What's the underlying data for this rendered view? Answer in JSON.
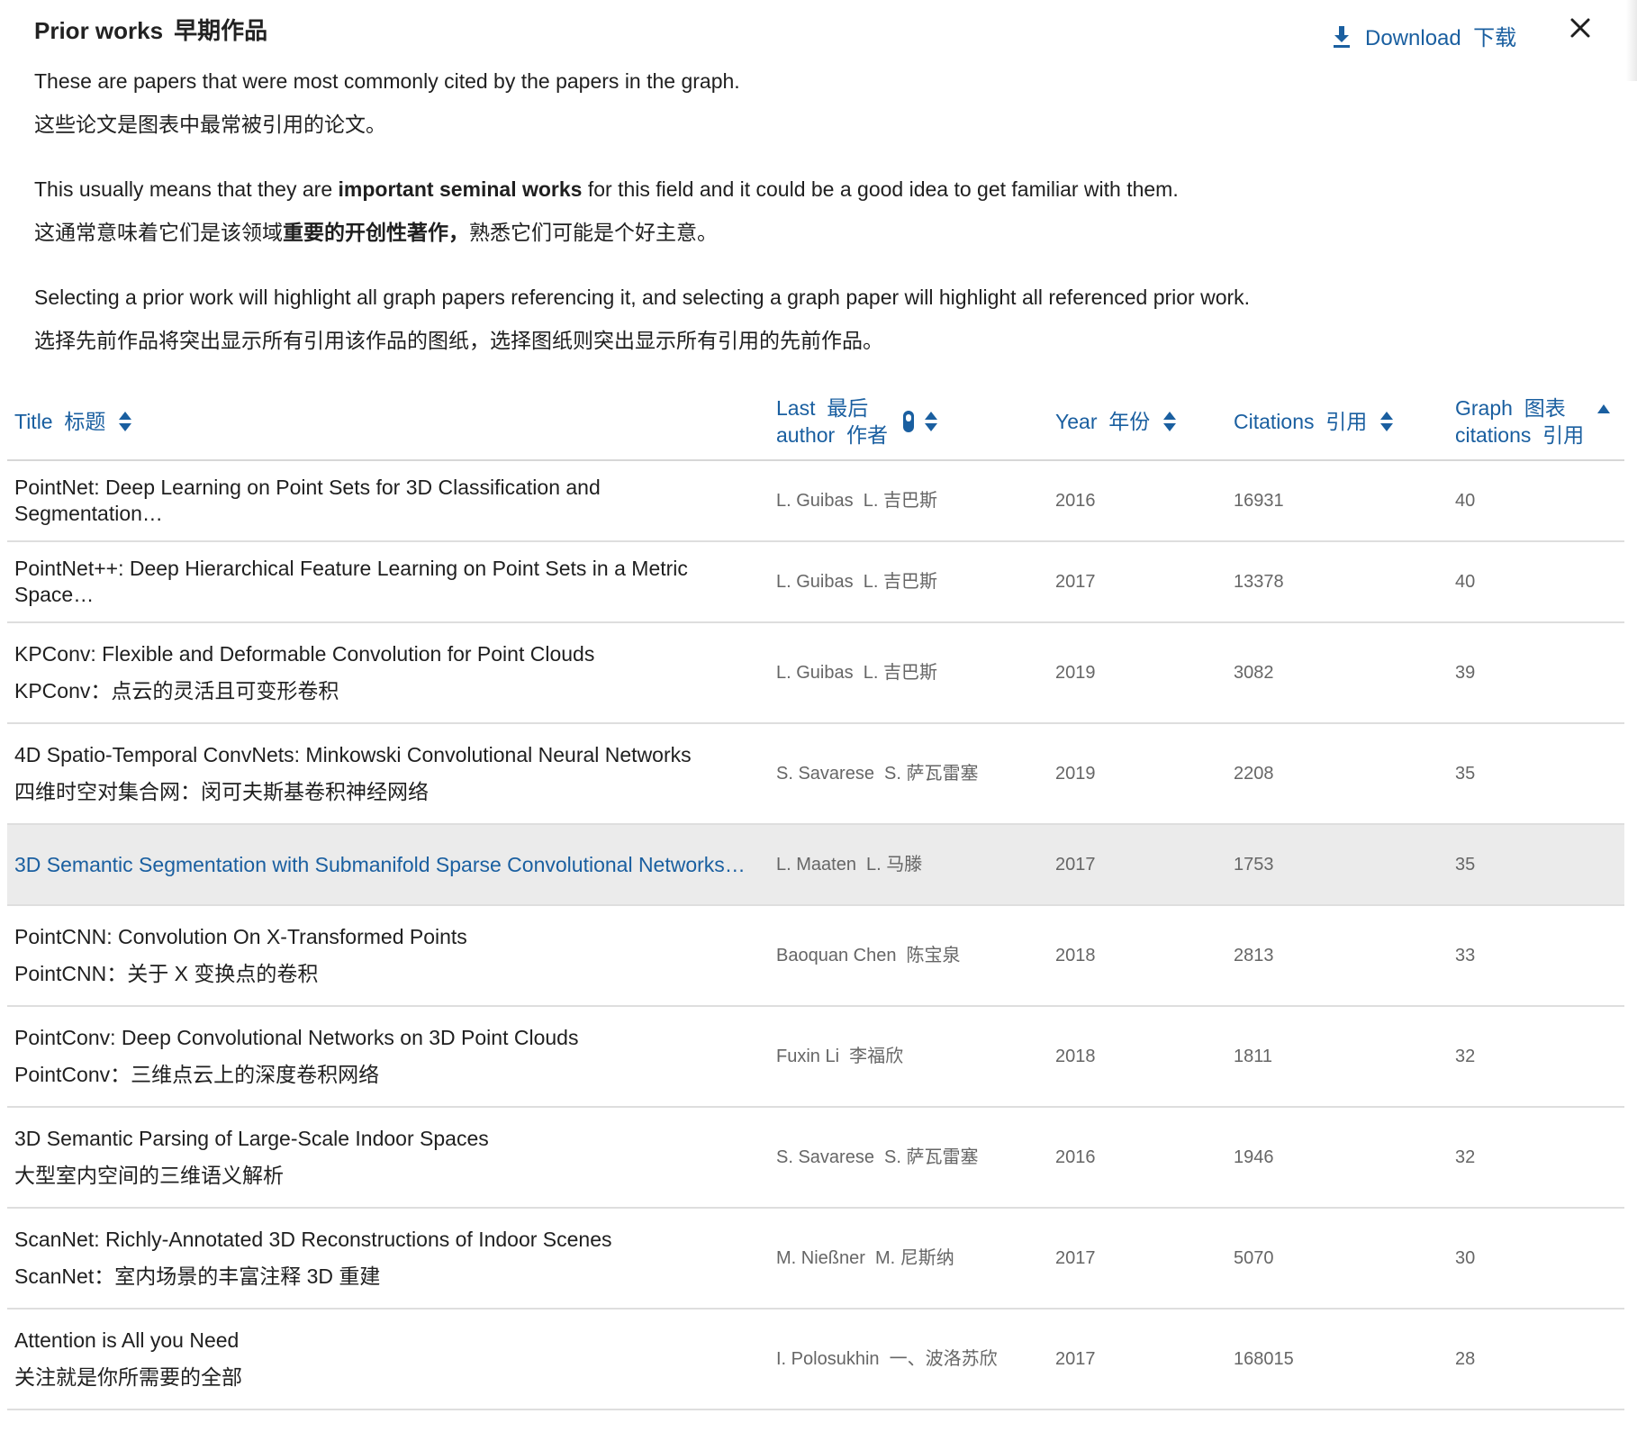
{
  "panel": {
    "title": "Prior works",
    "title_zh": "早期作品",
    "download_label": "Download  下载",
    "download_icon": "download-icon",
    "close_icon": "close-icon"
  },
  "intro": {
    "p1_en": "These are papers that were most commonly cited by the papers in the graph.",
    "p1_zh": "这些论文是图表中最常被引用的论文。",
    "p2_en_before": "This usually means that they are ",
    "p2_en_bold": "important seminal works",
    "p2_en_after": " for this field and it could be a good idea to get familiar with them.",
    "p2_zh_before": "这通常意味着它们是该领域",
    "p2_zh_bold": "重要的开创性著作，",
    "p2_zh_after": "熟悉它们可能是个好主意。",
    "p3_en": "Selecting a prior work will highlight all graph papers referencing it, and selecting a graph paper will highlight all referenced prior work.",
    "p3_zh": "选择先前作品将突出显示所有引用该作品的图纸，选择图纸则突出显示所有引用的先前作品。"
  },
  "table": {
    "headers": {
      "title": "Title  标题",
      "last_author_1": "Last  最后",
      "last_author_2": "author  作者",
      "year": "Year  年份",
      "citations": "Citations  引用",
      "graph_1": "Graph  图表",
      "graph_2": "citations  引用"
    },
    "rows": [
      {
        "title": "PointNet: Deep Learning on Point Sets for 3D Classification and Segmentation…",
        "title_zh": "",
        "author": "L. Guibas  L. 吉巴斯",
        "year": "2016",
        "citations": "16931",
        "graph": "40"
      },
      {
        "title": "PointNet++: Deep Hierarchical Feature Learning on Point Sets in a Metric Space…",
        "title_zh": "",
        "author": "L. Guibas  L. 吉巴斯",
        "year": "2017",
        "citations": "13378",
        "graph": "40"
      },
      {
        "title": "KPConv: Flexible and Deformable Convolution for Point Clouds",
        "title_zh": "KPConv：点云的灵活且可变形卷积",
        "author": "L. Guibas  L. 吉巴斯",
        "year": "2019",
        "citations": "3082",
        "graph": "39"
      },
      {
        "title": "4D Spatio-Temporal ConvNets: Minkowski Convolutional Neural Networks",
        "title_zh": "四维时空对集合网：闵可夫斯基卷积神经网络",
        "author": "S. Savarese  S. 萨瓦雷塞",
        "year": "2019",
        "citations": "2208",
        "graph": "35"
      },
      {
        "title": "3D Semantic Segmentation with Submanifold Sparse Convolutional Networks…",
        "title_zh": "",
        "author": "L. Maaten  L. 马滕",
        "year": "2017",
        "citations": "1753",
        "graph": "35"
      },
      {
        "title": "PointCNN: Convolution On X-Transformed Points",
        "title_zh": "PointCNN：关于 X 变换点的卷积",
        "author": "Baoquan Chen  陈宝泉",
        "year": "2018",
        "citations": "2813",
        "graph": "33"
      },
      {
        "title": "PointConv: Deep Convolutional Networks on 3D Point Clouds",
        "title_zh": "PointConv：三维点云上的深度卷积网络",
        "author": "Fuxin Li  李福欣",
        "year": "2018",
        "citations": "1811",
        "graph": "32"
      },
      {
        "title": "3D Semantic Parsing of Large-Scale Indoor Spaces",
        "title_zh": "大型室内空间的三维语义解析",
        "author": "S. Savarese  S. 萨瓦雷塞",
        "year": "2016",
        "citations": "1946",
        "graph": "32"
      },
      {
        "title": "ScanNet: Richly-Annotated 3D Reconstructions of Indoor Scenes",
        "title_zh": "ScanNet：室内场景的丰富注释 3D 重建",
        "author": "M. Nießner  M. 尼斯纳",
        "year": "2017",
        "citations": "5070",
        "graph": "30"
      },
      {
        "title": "Attention is All you Need",
        "title_zh": "关注就是你所需要的全部",
        "author": "I. Polosukhin  一、波洛苏欣",
        "year": "2017",
        "citations": "168015",
        "graph": "28"
      }
    ]
  },
  "colors": {
    "link": "#1a5fa0",
    "highlight_row": "#ebebeb",
    "muted_text": "#666666"
  }
}
